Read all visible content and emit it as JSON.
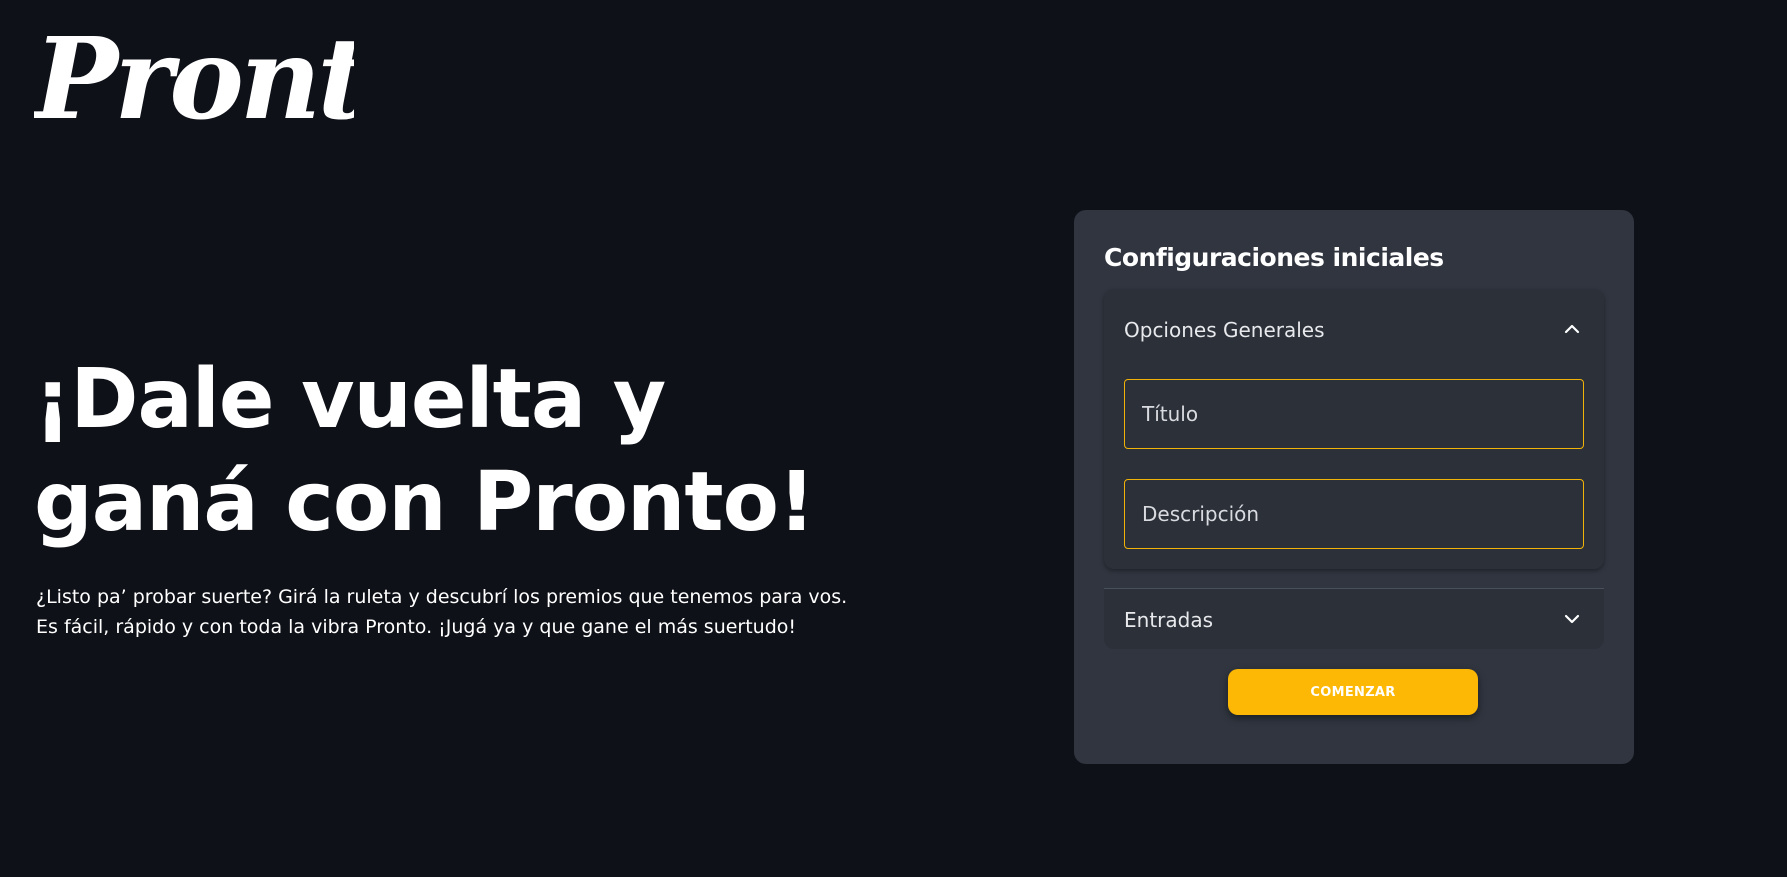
{
  "brand": {
    "logo_text": "Pronto"
  },
  "hero": {
    "title_line1": "¡Dale vuelta y",
    "title_line2": "ganá con Pronto!",
    "subtitle_line1": "¿Listo pa’ probar suerte? Girá la ruleta y descubrí los premios que tenemos para vos.",
    "subtitle_line2": "Es fácil, rápido y con toda la vibra Pronto. ¡Jugá ya y que gane el más suertudo!"
  },
  "config_card": {
    "title": "Configuraciones iniciales",
    "general_section": {
      "label": "Opciones Generales",
      "expanded": true,
      "icon": "chevron-up-icon",
      "titulo_field": {
        "placeholder": "Título",
        "value": ""
      },
      "descripcion_field": {
        "placeholder": "Descripción",
        "value": ""
      }
    },
    "entradas_section": {
      "label": "Entradas",
      "expanded": false,
      "icon": "chevron-down-icon"
    },
    "start_button_label": "COMENZAR"
  },
  "colors": {
    "background": "#0e1118",
    "card": "#30353f",
    "accordion": "#2b3039",
    "accent": "#fdb805",
    "field_border": "#f2b308",
    "text": "#ffffff"
  }
}
